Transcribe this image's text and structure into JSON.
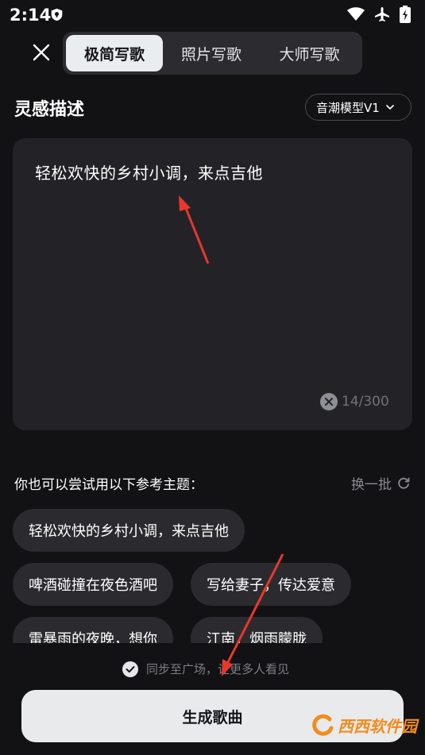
{
  "status_bar": {
    "time": "2:14"
  },
  "header": {
    "tabs": [
      {
        "label": "极简写歌",
        "active": true
      },
      {
        "label": "照片写歌",
        "active": false
      },
      {
        "label": "大师写歌",
        "active": false
      }
    ]
  },
  "inspiration": {
    "title": "灵感描述",
    "model": "音潮模型V1",
    "text": "轻松欢快的乡村小调，来点吉他",
    "count": "14/300"
  },
  "suggestions": {
    "label": "你也可以尝试用以下参考主题：",
    "refresh_label": "换一批",
    "chips": [
      "轻松欢快的乡村小调，来点吉他",
      "啤酒碰撞在夜色酒吧",
      "写给妻子，传达爱意",
      "雷暴雨的夜晚，想你",
      "江南，烟雨朦胧"
    ]
  },
  "footer": {
    "sync_text": "同步至广场，让更多人看见",
    "generate_label": "生成歌曲"
  },
  "watermark": {
    "text": "西西软件园"
  },
  "colors": {
    "background": "#121214",
    "panel": "#232327",
    "chip": "#2b2b2f",
    "button": "#e8eaec",
    "annotation": "#e8372c"
  }
}
